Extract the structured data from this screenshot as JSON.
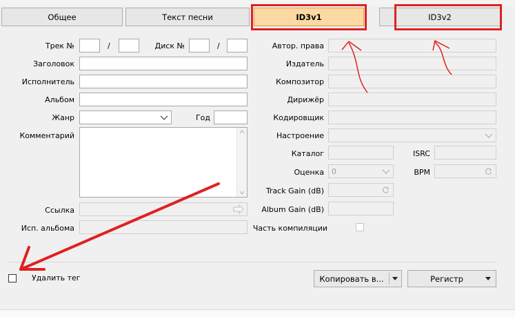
{
  "window": {
    "title_fragment": "..."
  },
  "tabs": [
    {
      "label": "Общее"
    },
    {
      "label": "Текст песни"
    },
    {
      "label": "ID3v1",
      "active": true
    },
    {
      "label": "ID3v2"
    }
  ],
  "left": {
    "track_label": "Трек №",
    "disc_label": "Диск №",
    "slash": "/",
    "title_label": "Заголовок",
    "artist_label": "Исполнитель",
    "album_label": "Альбом",
    "genre_label": "Жанр",
    "year_label": "Год",
    "comment_label": "Комментарий",
    "link_label": "Ссылка",
    "album_artist_label": "Исп. альбома"
  },
  "right": {
    "copyright_label": "Автор. права",
    "publisher_label": "Издатель",
    "composer_label": "Композитор",
    "conductor_label": "Дирижёр",
    "encoder_label": "Кодировщик",
    "mood_label": "Настроение",
    "catalog_label": "Каталог",
    "isrc_label": "ISRC",
    "rating_label": "Оценка",
    "rating_value": "0",
    "bpm_label": "BPM",
    "track_gain_label": "Track Gain (dB)",
    "album_gain_label": "Album Gain (dB)",
    "compilation_label": "Часть компиляции"
  },
  "footer": {
    "delete_tag_label": "Удалить тег",
    "copy_button": "Копировать в...",
    "case_button": "Регистр"
  },
  "colors": {
    "annotation": "#e02020",
    "active_tab": "#fcd9a2"
  }
}
